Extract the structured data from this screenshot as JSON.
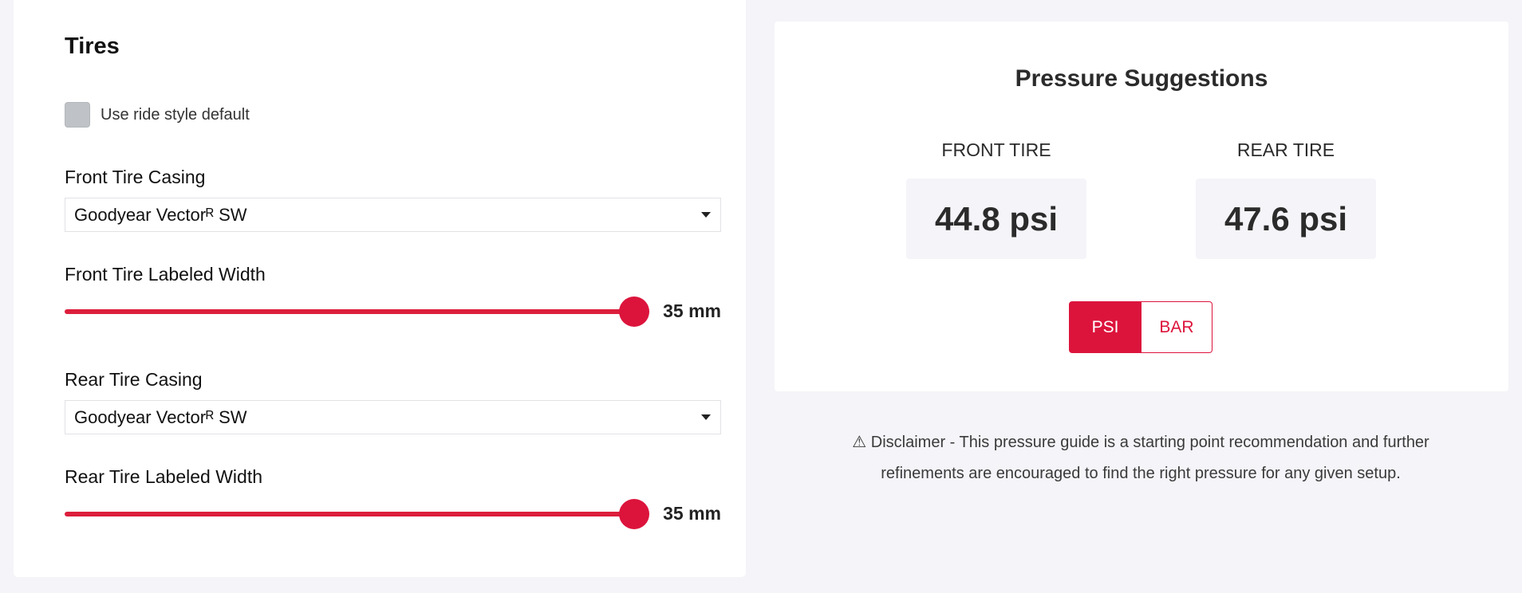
{
  "tires": {
    "title": "Tires",
    "ride_style_default": {
      "label": "Use ride style default",
      "checked": false
    },
    "front_casing": {
      "label": "Front Tire Casing",
      "value": "Goodyear Vectorᴿ SW"
    },
    "front_width": {
      "label": "Front Tire Labeled Width",
      "value": "35 mm",
      "fraction": 1.0
    },
    "rear_casing": {
      "label": "Rear Tire Casing",
      "value": "Goodyear Vectorᴿ SW"
    },
    "rear_width": {
      "label": "Rear Tire Labeled Width",
      "value": "35 mm",
      "fraction": 1.0
    }
  },
  "pressure": {
    "title": "Pressure Suggestions",
    "front": {
      "label": "FRONT TIRE",
      "value": "44.8 psi"
    },
    "rear": {
      "label": "REAR TIRE",
      "value": "47.6 psi"
    },
    "units": {
      "psi": "PSI",
      "bar": "BAR",
      "selected": "PSI"
    }
  },
  "disclaimer": {
    "line1": "⚠ Disclaimer - This pressure guide is a starting point recommendation and further",
    "line2": "refinements are encouraged to find the right pressure for any given setup."
  },
  "colors": {
    "accent": "#dc143c",
    "background": "#f4f4f9"
  },
  "icons": {
    "dropdown": "caret-down-icon",
    "warning": "warning-icon"
  }
}
